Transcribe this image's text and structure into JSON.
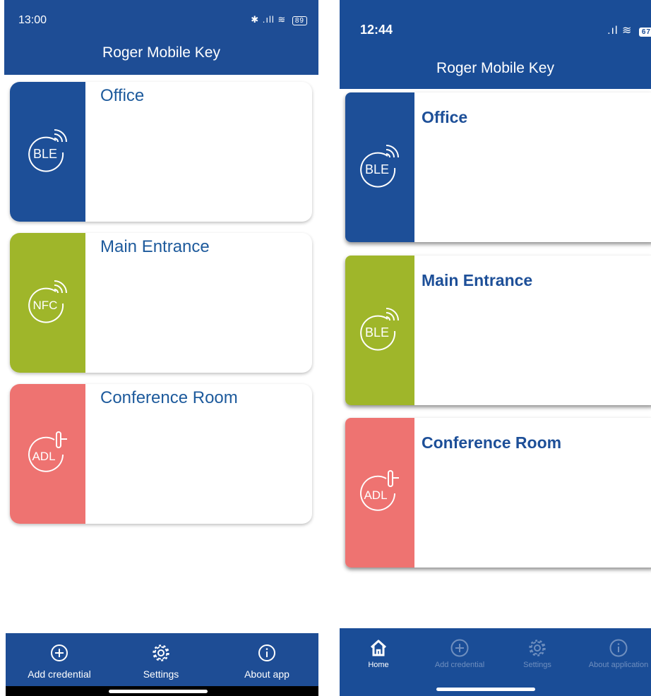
{
  "left_screen": {
    "status": {
      "time": "13:00",
      "battery": "89"
    },
    "app_title": "Roger Mobile Key",
    "cards": [
      {
        "title": "Office",
        "type": "BLE",
        "color": "#1d4f98"
      },
      {
        "title": "Main Entrance",
        "type": "NFC",
        "color": "#9fb62a"
      },
      {
        "title": "Conference Room",
        "type": "ADL",
        "color": "#ee7371"
      }
    ],
    "tabs": [
      {
        "label": "Add credential",
        "icon": "plus-circle-icon"
      },
      {
        "label": "Settings",
        "icon": "gear-icon"
      },
      {
        "label": "About app",
        "icon": "info-icon"
      }
    ]
  },
  "right_screen": {
    "status": {
      "time": "12:44",
      "battery": "67"
    },
    "app_title": "Roger Mobile Key",
    "cards": [
      {
        "title": "Office",
        "type": "BLE",
        "color": "#1d4f98"
      },
      {
        "title": "Main Entrance",
        "type": "BLE",
        "color": "#9fb62a"
      },
      {
        "title": "Conference Room",
        "type": "ADL",
        "color": "#ee7371"
      }
    ],
    "tabs": [
      {
        "label": "Home",
        "icon": "home-icon",
        "active": true
      },
      {
        "label": "Add credential",
        "icon": "plus-circle-icon"
      },
      {
        "label": "Settings",
        "icon": "gear-icon"
      },
      {
        "label": "About application",
        "icon": "info-icon"
      }
    ]
  }
}
